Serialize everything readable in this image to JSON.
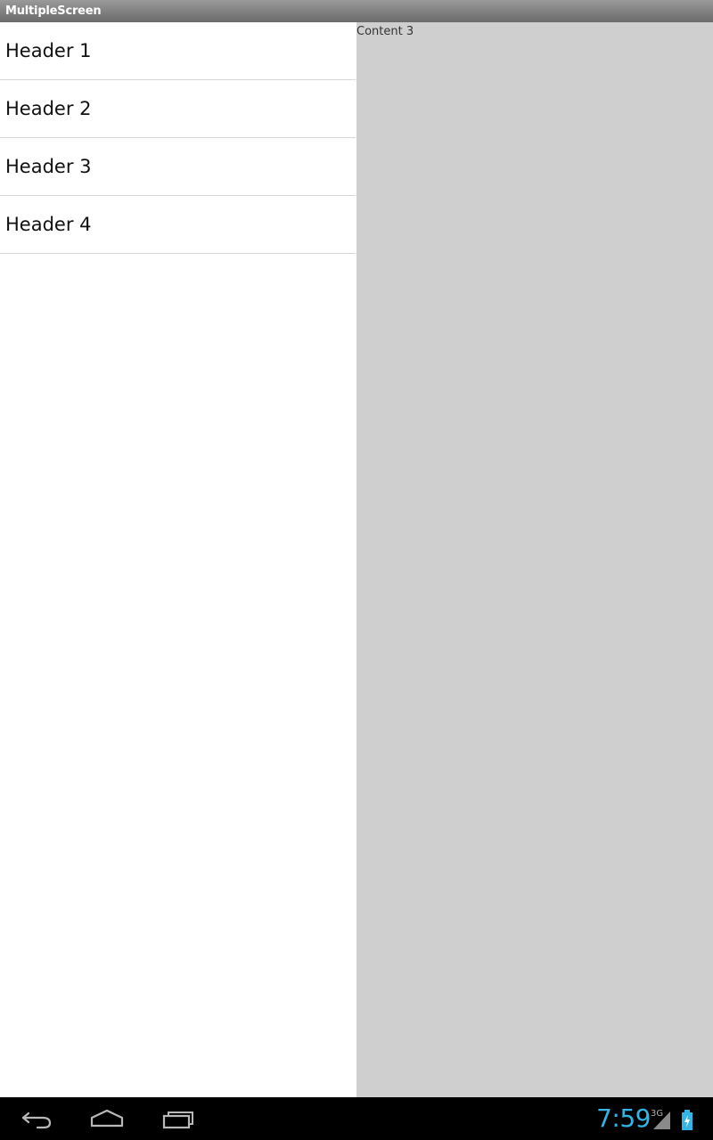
{
  "app": {
    "title": "MultipleScreen"
  },
  "list": {
    "items": [
      {
        "label": "Header 1"
      },
      {
        "label": "Header 2"
      },
      {
        "label": "Header 3"
      },
      {
        "label": "Header 4"
      }
    ]
  },
  "detail": {
    "content_label": "Content 3"
  },
  "system_bar": {
    "time": "7:59",
    "network_type": "3G",
    "icons": [
      "back-icon",
      "home-icon",
      "recent-apps-icon",
      "signal-icon",
      "battery-charging-icon"
    ]
  },
  "colors": {
    "title_bar": "#808080",
    "detail_background": "#cfcfcf",
    "clock": "#33b5e5",
    "nav_bar": "#000000"
  }
}
